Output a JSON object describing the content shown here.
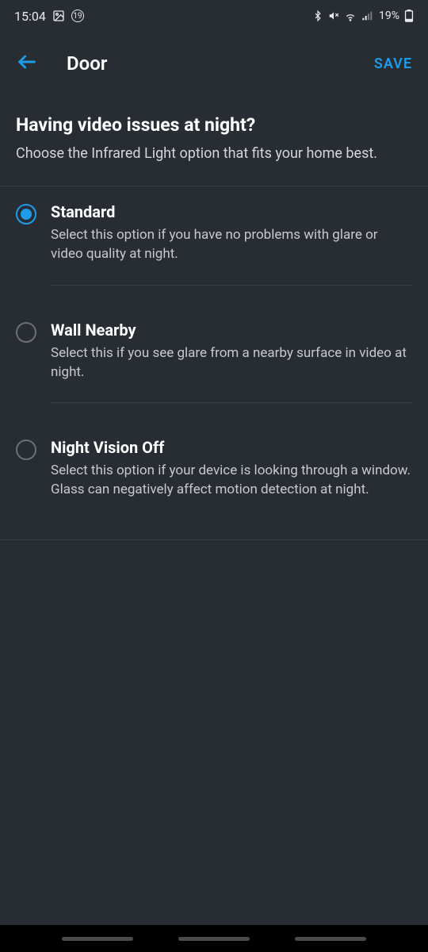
{
  "status": {
    "time": "15:04",
    "badge": "19",
    "battery": "19%"
  },
  "appbar": {
    "title": "Door",
    "save": "SAVE"
  },
  "intro": {
    "title": "Having video issues at night?",
    "sub": "Choose the Infrared Light option that fits your home best."
  },
  "options": [
    {
      "title": "Standard",
      "desc": "Select this option if you have no problems with glare or video quality at night.",
      "selected": true
    },
    {
      "title": "Wall Nearby",
      "desc": "Select this if you see glare from a nearby surface in video at night.",
      "selected": false
    },
    {
      "title": "Night Vision Off",
      "desc": "Select this option if your device is looking through a window. Glass can negatively affect motion detection at night.",
      "selected": false
    }
  ]
}
